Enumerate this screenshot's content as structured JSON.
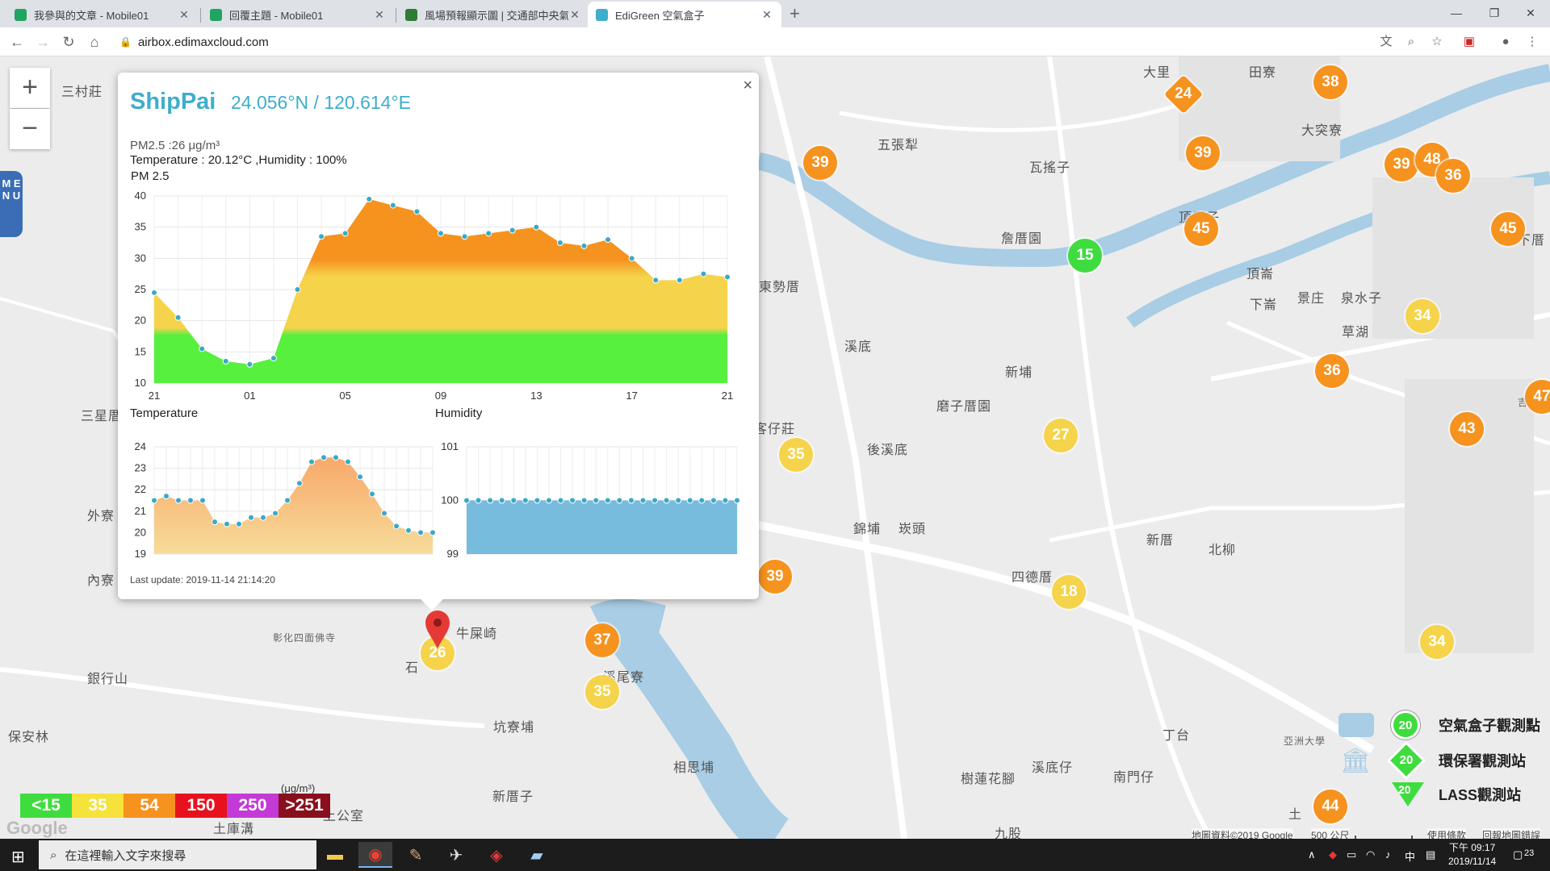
{
  "browser": {
    "tabs": [
      {
        "title": "我參與的文章 - Mobile01",
        "favicon_color": "#1fa463"
      },
      {
        "title": "回覆主題 - Mobile01",
        "favicon_color": "#1fa463"
      },
      {
        "title": "風場預報顯示圖 | 交通部中央氣象",
        "favicon_color": "#2e7d32"
      },
      {
        "title": "EdiGreen 空氣盒子",
        "favicon_color": "#3eaecb"
      }
    ],
    "url": "airbox.edimaxcloud.com"
  },
  "popup": {
    "site_name": "ShipPai",
    "coordinates": "24.056°N / 120.614°E",
    "pm25_line": "PM2.5 :26 μg/m³",
    "temp_humidity_line": "Temperature : 20.12°C ,Humidity : 100%",
    "pm_chart_label": "PM 2.5",
    "temperature_title": "Temperature",
    "humidity_title": "Humidity",
    "last_update": "Last update: 2019-11-14 21:14:20",
    "close_symbol": "×"
  },
  "chart_data": [
    {
      "type": "area",
      "title": "PM 2.5",
      "x_tick_labels": [
        "21",
        "01",
        "05",
        "09",
        "13",
        "17",
        "21"
      ],
      "ylim": [
        10,
        40
      ],
      "y_ticks": [
        10,
        15,
        20,
        25,
        30,
        35,
        40
      ],
      "values": [
        24.5,
        20.5,
        15.5,
        13.5,
        13,
        14,
        25,
        33.5,
        34,
        39.5,
        38.5,
        37.5,
        34,
        33.5,
        34,
        34.5,
        35,
        32.5,
        32,
        33,
        30,
        26.5,
        26.5,
        27.5,
        27
      ]
    },
    {
      "type": "area",
      "title": "Temperature",
      "ylim": [
        19,
        24
      ],
      "y_ticks": [
        19,
        20,
        21,
        22,
        23,
        24
      ],
      "values": [
        21.5,
        21.7,
        21.5,
        21.5,
        21.5,
        20.5,
        20.4,
        20.4,
        20.7,
        20.7,
        20.9,
        21.5,
        22.3,
        23.3,
        23.5,
        23.5,
        23.3,
        22.6,
        21.8,
        20.9,
        20.3,
        20.1,
        20.0,
        20.0
      ]
    },
    {
      "type": "area",
      "title": "Humidity",
      "ylim": [
        99,
        101
      ],
      "y_ticks": [
        99,
        100,
        101
      ],
      "values": [
        100,
        100,
        100,
        100,
        100,
        100,
        100,
        100,
        100,
        100,
        100,
        100,
        100,
        100,
        100,
        100,
        100,
        100,
        100,
        100,
        100,
        100,
        100,
        100
      ]
    }
  ],
  "map": {
    "places": [
      {
        "name": "三村莊"
      },
      {
        "name": "五張犁"
      },
      {
        "name": "瓦搖子"
      },
      {
        "name": "大突寮"
      },
      {
        "name": "詹厝園"
      },
      {
        "name": "頂厝子"
      },
      {
        "name": "田寮"
      },
      {
        "name": "溪底"
      },
      {
        "name": "新埔"
      },
      {
        "name": "磨子厝園"
      },
      {
        "name": "後溪底"
      },
      {
        "name": "錦埔"
      },
      {
        "name": "崁頭"
      },
      {
        "name": "四德厝"
      },
      {
        "name": "新厝"
      },
      {
        "name": "北柳"
      },
      {
        "name": "頂崙"
      },
      {
        "name": "景庄"
      },
      {
        "name": "泉水子"
      },
      {
        "name": "草湖"
      },
      {
        "name": "下崙"
      },
      {
        "name": "東勢厝"
      },
      {
        "name": "客仔莊"
      },
      {
        "name": "三星厝"
      },
      {
        "name": "外寮"
      },
      {
        "name": "內寮"
      },
      {
        "name": "銀行山"
      },
      {
        "name": "保安林"
      },
      {
        "name": "牛屎崎"
      },
      {
        "name": "石"
      },
      {
        "name": "溪尾寮"
      },
      {
        "name": "坑寮埔"
      },
      {
        "name": "相思埔"
      },
      {
        "name": "新厝子"
      },
      {
        "name": "溪底仔"
      },
      {
        "name": "南門仔"
      },
      {
        "name": "丁台"
      },
      {
        "name": "樹蓮花腳"
      },
      {
        "name": "九股"
      },
      {
        "name": "土庫溝"
      },
      {
        "name": "上公室"
      },
      {
        "name": "彰化四面佛寺"
      },
      {
        "name": "大里"
      },
      {
        "name": "亞洲大學"
      },
      {
        "name": "下厝"
      },
      {
        "name": "吉"
      },
      {
        "name": "土"
      }
    ],
    "markers": [
      {
        "value": "24",
        "color": "#f6921e"
      },
      {
        "value": "38",
        "color": "#f6921e"
      },
      {
        "value": "39",
        "color": "#f6921e"
      },
      {
        "value": "39",
        "color": "#f6921e"
      },
      {
        "value": "39",
        "color": "#f6921e"
      },
      {
        "value": "48",
        "color": "#f6921e"
      },
      {
        "value": "36",
        "color": "#f6921e"
      },
      {
        "value": "45",
        "color": "#f6921e"
      },
      {
        "value": "45",
        "color": "#f6921e"
      },
      {
        "value": "15",
        "color": "#3fdc3f"
      },
      {
        "value": "34",
        "color": "#f5d34a"
      },
      {
        "value": "36",
        "color": "#f6921e"
      },
      {
        "value": "27",
        "color": "#f5d34a"
      },
      {
        "value": "35",
        "color": "#f5d34a"
      },
      {
        "value": "43",
        "color": "#f6921e"
      },
      {
        "value": "47",
        "color": "#f6921e"
      },
      {
        "value": "39",
        "color": "#f6921e"
      },
      {
        "value": "18",
        "color": "#f5d34a"
      },
      {
        "value": "37",
        "color": "#f6921e"
      },
      {
        "value": "35",
        "color": "#f5d34a"
      },
      {
        "value": "26",
        "color": "#f5d34a"
      },
      {
        "value": "34",
        "color": "#f5d34a"
      },
      {
        "value": "44",
        "color": "#f6921e"
      }
    ],
    "zoom_in": "+",
    "zoom_out": "−",
    "menu_label": "M E N U",
    "aqi_legend": [
      {
        "label": "<15",
        "color": "#3fdc3f"
      },
      {
        "label": "35",
        "color": "#f5e23a"
      },
      {
        "label": "54",
        "color": "#f6921e"
      },
      {
        "label": "150",
        "color": "#e8121e"
      },
      {
        "label": "250",
        "color": "#c43ad6"
      },
      {
        "label": ">251",
        "color": "#8a0f1c"
      }
    ],
    "legend_unit": "(μg/m³)",
    "station_legend": [
      {
        "label": "空氣盒子觀測點",
        "value": "20"
      },
      {
        "label": "環保署觀測站",
        "value": "20"
      },
      {
        "label": "LASS觀測站",
        "value": "20"
      }
    ],
    "google_logo": "Google",
    "attribution": "地圖資料©2019 Google",
    "scale": "500 公尺",
    "terms": "使用條款",
    "report": "回報地圖錯誤"
  },
  "taskbar": {
    "search_placeholder": "在這裡輸入文字來搜尋",
    "ime": "中",
    "time": "下午 09:17",
    "date": "2019/11/14",
    "notifications": "23"
  }
}
